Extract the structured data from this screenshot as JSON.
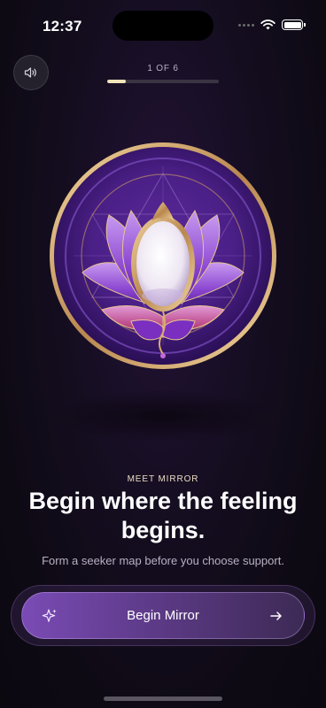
{
  "status_bar": {
    "time": "12:37"
  },
  "header": {
    "sound_icon": "speaker-icon",
    "progress_label": "1 OF 6",
    "progress_fraction": 0.1667
  },
  "hero": {
    "image_name": "lotus-mirror-illustration"
  },
  "content": {
    "eyebrow": "MEET MIRROR",
    "headline": "Begin where the feeling begins.",
    "subtitle": "Form a seeker map before you choose support."
  },
  "cta": {
    "label": "Begin Mirror",
    "left_icon": "sparkle-icon",
    "right_icon": "arrow-right-icon"
  },
  "colors": {
    "accent_gold": "#f1e4b8",
    "button_purple": "#7a4bb5",
    "background": "#140d1f"
  }
}
